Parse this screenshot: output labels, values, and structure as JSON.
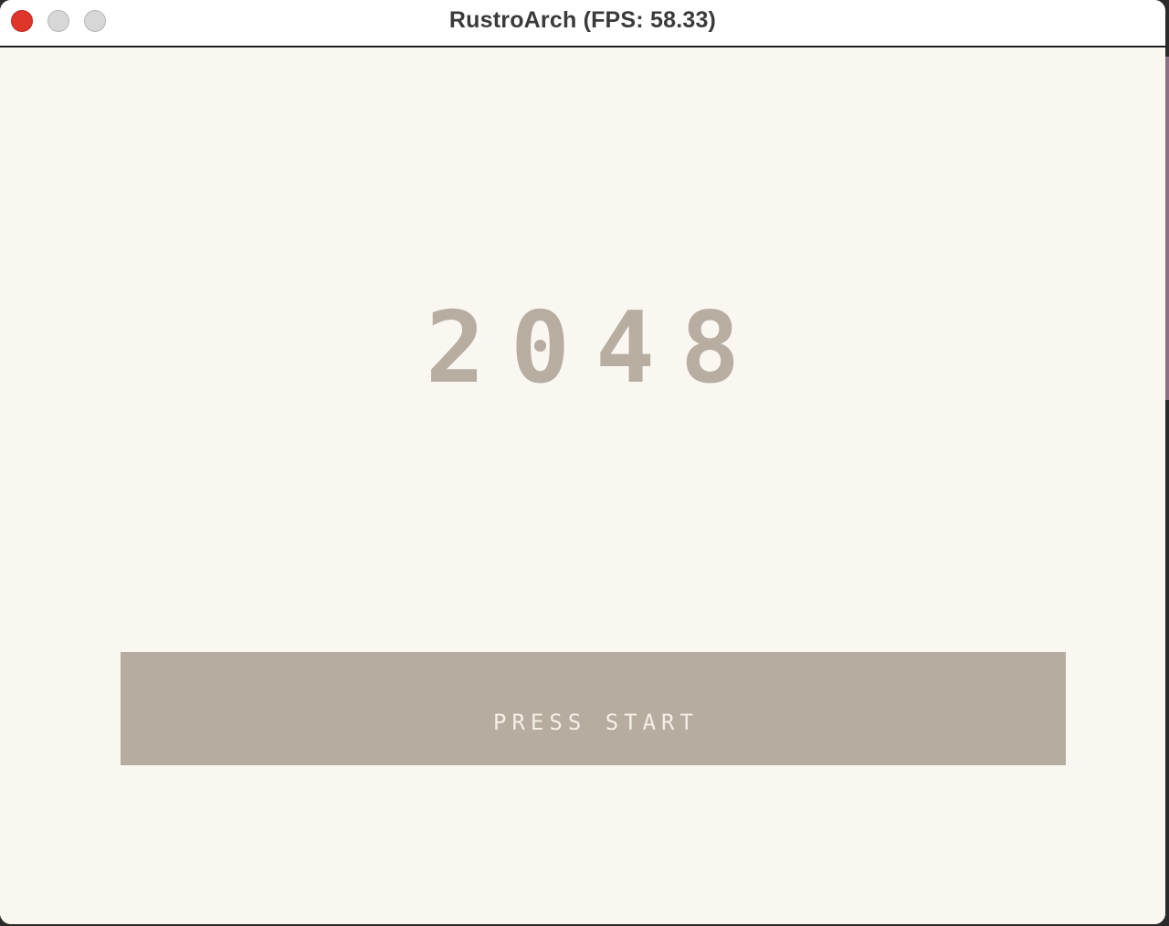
{
  "window": {
    "title": "RustroArch (FPS: 58.33)"
  },
  "game": {
    "logo_text": "2048",
    "start_prompt": "PRESS START"
  },
  "colors": {
    "background": "#faf7f1",
    "logo": "#b7ada1",
    "start_bar": "#b6aca0",
    "start_text": "#f5efe5",
    "close_button": "#e0352b",
    "inactive_button": "#d7d7d7"
  },
  "icons": [
    "close-icon",
    "minimize-icon",
    "zoom-icon"
  ]
}
